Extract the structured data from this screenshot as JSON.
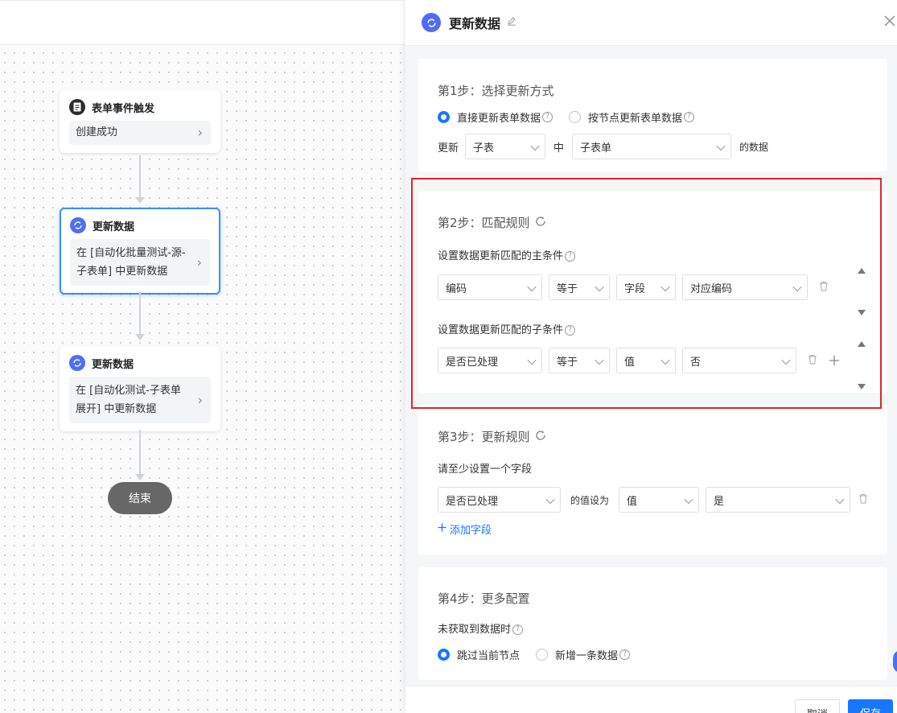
{
  "flow": {
    "trigger": {
      "title": "表单事件触发",
      "body": "创建成功"
    },
    "update1": {
      "title": "更新数据",
      "body_line1": "在 [自动化批量测试-源-",
      "body_line2": "子表单] 中更新数据"
    },
    "update2": {
      "title": "更新数据",
      "body_line1": "在 [自动化测试-子表单",
      "body_line2": "展开] 中更新数据"
    },
    "end": "结束"
  },
  "drawer": {
    "title": "更新数据",
    "step1": {
      "title": "第1步：选择更新方式",
      "option_direct": "直接更新表单数据",
      "option_node": "按节点更新表单数据",
      "update_prefix": "更新",
      "field_value": "子表",
      "middle": "中",
      "target_value": "子表单",
      "suffix": "的数据"
    },
    "step2": {
      "title": "第2步：匹配规则",
      "main_label": "设置数据更新匹配的主条件",
      "main": {
        "field": "编码",
        "operator": "等于",
        "type": "字段",
        "value": "对应编码"
      },
      "sub_label": "设置数据更新匹配的子条件",
      "sub": {
        "field": "是否已处理",
        "operator": "等于",
        "type": "值",
        "value": "否"
      }
    },
    "step3": {
      "title": "第3步：更新规则",
      "hint": "请至少设置一个字段",
      "rule": {
        "field": "是否已处理",
        "middle": "的值设为",
        "type": "值",
        "value": "是"
      },
      "add_field": "添加字段"
    },
    "step4": {
      "title": "第4步：更多配置",
      "label": "未获取到数据时",
      "option_skip": "跳过当前节点",
      "option_add": "新增一条数据"
    },
    "footer": {
      "cancel": "取消",
      "save": "保存"
    }
  },
  "colors": {
    "accent": "#1677ff",
    "node_icon": "#4f6ef7",
    "highlight": "#e0262b"
  },
  "icons": {
    "trigger": "document-icon",
    "update": "sync-icon",
    "edit": "pencil-icon",
    "close": "close-icon"
  }
}
